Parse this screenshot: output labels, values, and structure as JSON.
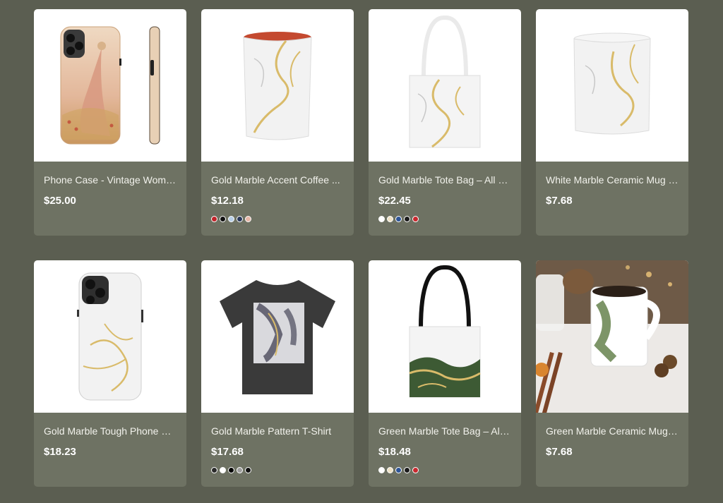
{
  "products": [
    {
      "title": "Phone Case - Vintage Woma...",
      "price": "$25.00",
      "swatches": []
    },
    {
      "title": "Gold Marble Accent Coffee ...",
      "price": "$12.18",
      "swatches": [
        "#c0242a",
        "#111111",
        "#b8cfe8",
        "#2c3a5c",
        "#e7b7a8"
      ]
    },
    {
      "title": "Gold Marble Tote Bag – All O...",
      "price": "$22.45",
      "swatches": [
        "#ffffff",
        "#efe2c6",
        "#2f5597",
        "#1c1c1c",
        "#c8282e"
      ]
    },
    {
      "title": "White Marble Ceramic Mug –...",
      "price": "$7.68",
      "swatches": []
    },
    {
      "title": "Gold Marble Tough Phone Ca...",
      "price": "$18.23",
      "swatches": []
    },
    {
      "title": "Gold Marble Pattern T-Shirt",
      "price": "$17.68",
      "swatches": [
        "#2a2a2a",
        "#ffffff",
        "#000000",
        "#9e9e9e",
        "#111111"
      ]
    },
    {
      "title": "Green Marble Tote Bag – All ...",
      "price": "$18.48",
      "swatches": [
        "#ffffff",
        "#efe2c6",
        "#2f5597",
        "#1c1c1c",
        "#c8282e"
      ]
    },
    {
      "title": "Green Marble Ceramic Mug - ...",
      "price": "$7.68",
      "swatches": []
    }
  ]
}
